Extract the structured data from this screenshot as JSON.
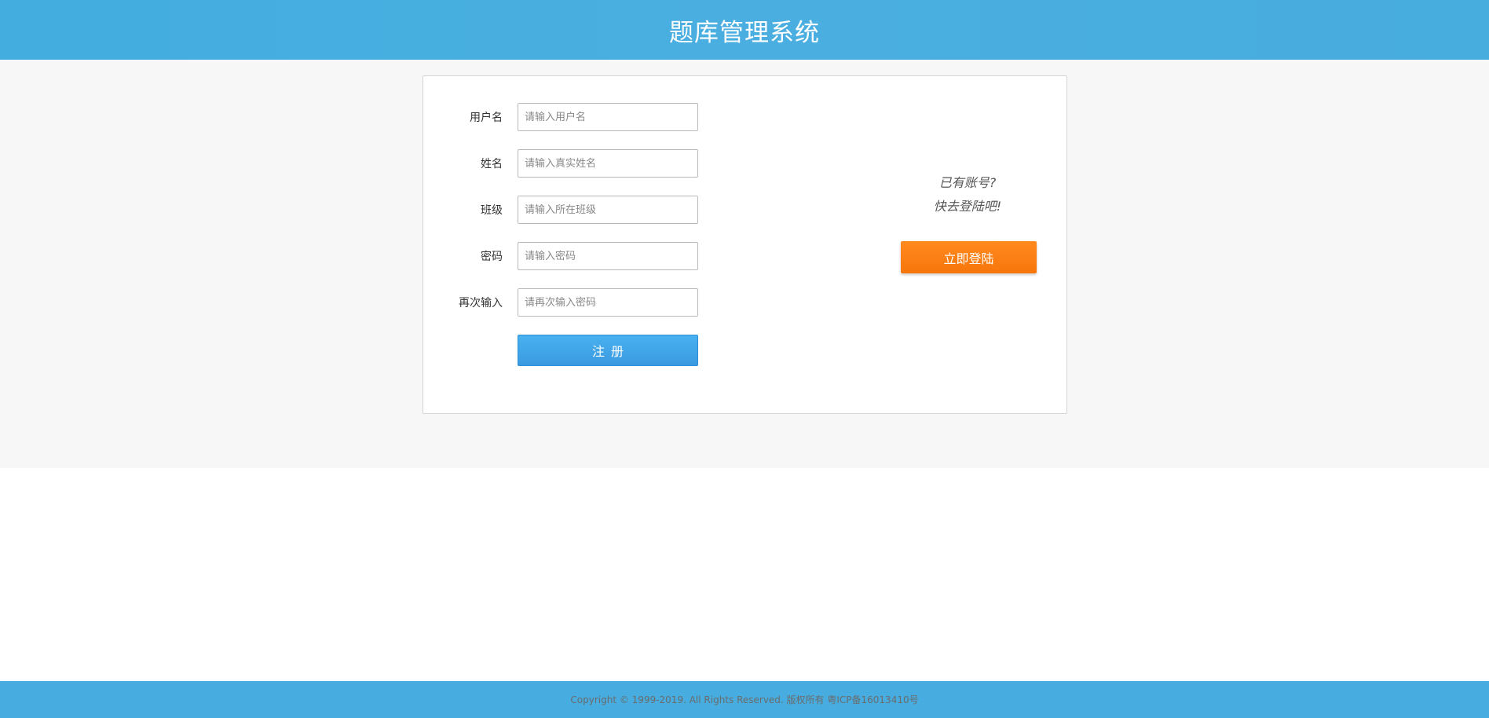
{
  "header": {
    "title": "题库管理系统"
  },
  "form": {
    "fields": [
      {
        "label": "用户名",
        "placeholder": "请输入用户名"
      },
      {
        "label": "姓名",
        "placeholder": "请输入真实姓名"
      },
      {
        "label": "班级",
        "placeholder": "请输入所在班级"
      },
      {
        "label": "密码",
        "placeholder": "请输入密码"
      },
      {
        "label": "再次输入",
        "placeholder": "请再次输入密码"
      }
    ],
    "register_label": "注册"
  },
  "side": {
    "line1": "已有账号?",
    "line2": "快去登陆吧!",
    "login_label": "立即登陆"
  },
  "footer": {
    "copyright": "Copyright © 1999-2019. All Rights Reserved. 版权所有 粤ICP备16013410号"
  },
  "colors": {
    "header_bg": "#47ade0",
    "register_button": "#3ea4e8",
    "login_button": "#fb7f14"
  }
}
